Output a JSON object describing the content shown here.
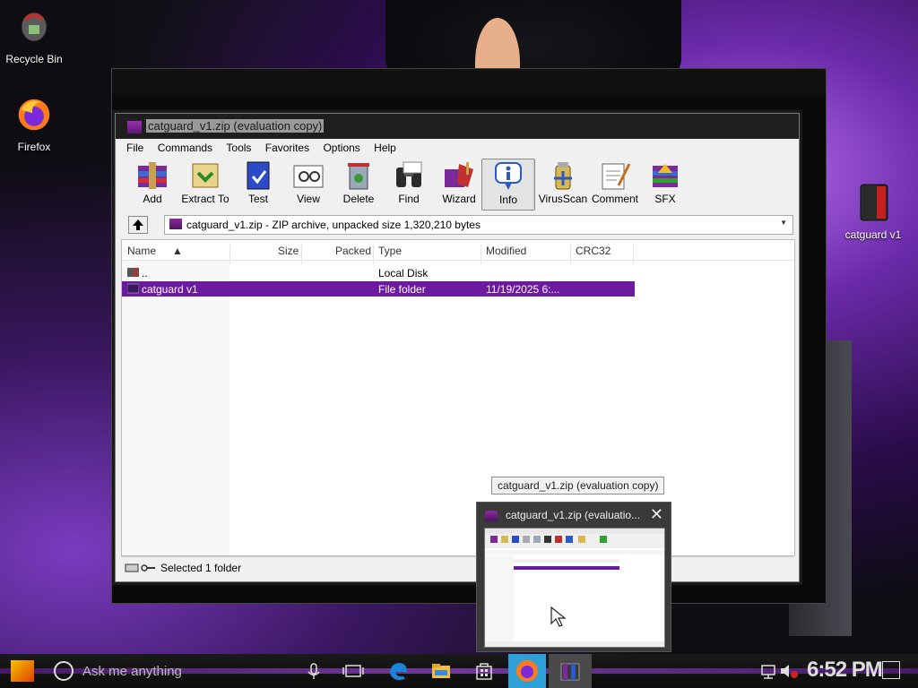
{
  "desktop": {
    "icons": [
      {
        "label": "Recycle Bin"
      },
      {
        "label": "Firefox"
      },
      {
        "label": "catguard v1"
      }
    ]
  },
  "window": {
    "title": "catguard_v1.zip (evaluation copy)",
    "menu": [
      "File",
      "Commands",
      "Tools",
      "Favorites",
      "Options",
      "Help"
    ],
    "toolbar": [
      {
        "label": "Add",
        "icon": "add-archive-icon"
      },
      {
        "label": "Extract To",
        "icon": "extract-icon"
      },
      {
        "label": "Test",
        "icon": "test-icon"
      },
      {
        "label": "View",
        "icon": "view-icon"
      },
      {
        "label": "Delete",
        "icon": "delete-icon"
      },
      {
        "label": "Find",
        "icon": "find-binoculars-icon"
      },
      {
        "label": "Wizard",
        "icon": "wizard-icon"
      },
      {
        "label": "Info",
        "icon": "info-icon"
      },
      {
        "label": "VirusScan",
        "icon": "virusscan-icon"
      },
      {
        "label": "Comment",
        "icon": "comment-icon"
      },
      {
        "label": "SFX",
        "icon": "sfx-icon"
      }
    ],
    "address": "catguard_v1.zip - ZIP archive, unpacked size 1,320,210 bytes",
    "columns": [
      "Name",
      "Size",
      "Packed",
      "Type",
      "Modified",
      "CRC32"
    ],
    "rows": [
      {
        "name": "..",
        "size": "",
        "packed": "",
        "type": "Local Disk",
        "modified": "",
        "crc": "",
        "selected": false
      },
      {
        "name": "catguard v1",
        "size": "",
        "packed": "",
        "type": "File folder",
        "modified": "11/19/2025 6:...",
        "crc": "",
        "selected": true
      }
    ],
    "status": "Selected 1 folder"
  },
  "tooltip": "catguard_v1.zip (evaluation copy)",
  "preview": {
    "title": "catguard_v1.zip (evaluatio..."
  },
  "taskbar": {
    "search_placeholder": "Ask me anything",
    "clock": "6:52 PM"
  },
  "colors": {
    "selection": "#6c1a9e",
    "accent": "#9a4ad0",
    "firefox_tile": "#2f9fd8"
  }
}
